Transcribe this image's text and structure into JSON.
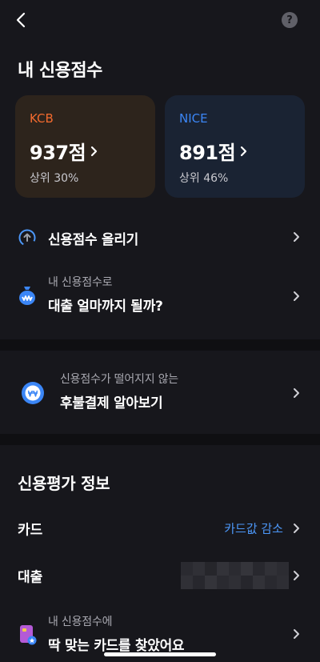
{
  "header": {
    "title": "내 신용점수",
    "help_label": "?"
  },
  "scores": [
    {
      "agency": "KCB",
      "score": "937점",
      "rank": "상위 30%",
      "accent": "#f26a2e"
    },
    {
      "agency": "NICE",
      "score": "891점",
      "rank": "상위 46%",
      "accent": "#3b86f6"
    }
  ],
  "actions": {
    "raise": {
      "label": "신용점수 올리기",
      "icon": "upload-circle-icon"
    },
    "loan": {
      "sub": "내 신용점수로",
      "main": "대출 얼마까지 될까?",
      "icon": "money-bag-icon"
    },
    "bnpl": {
      "sub": "신용점수가 떨어지지 않는",
      "main": "후불결제 알아보기",
      "icon": "won-coin-icon"
    }
  },
  "credit_info": {
    "title": "신용평가 정보",
    "rows": [
      {
        "label": "카드",
        "value": "카드값 감소"
      },
      {
        "label": "대출",
        "value": ""
      }
    ]
  },
  "promo": {
    "sub": "내 신용점수에",
    "main": "딱 맞는 카드를 찾았어요",
    "icon": "card-star-icon"
  },
  "colors": {
    "background": "#17171c",
    "link_blue": "#4c97f8"
  }
}
